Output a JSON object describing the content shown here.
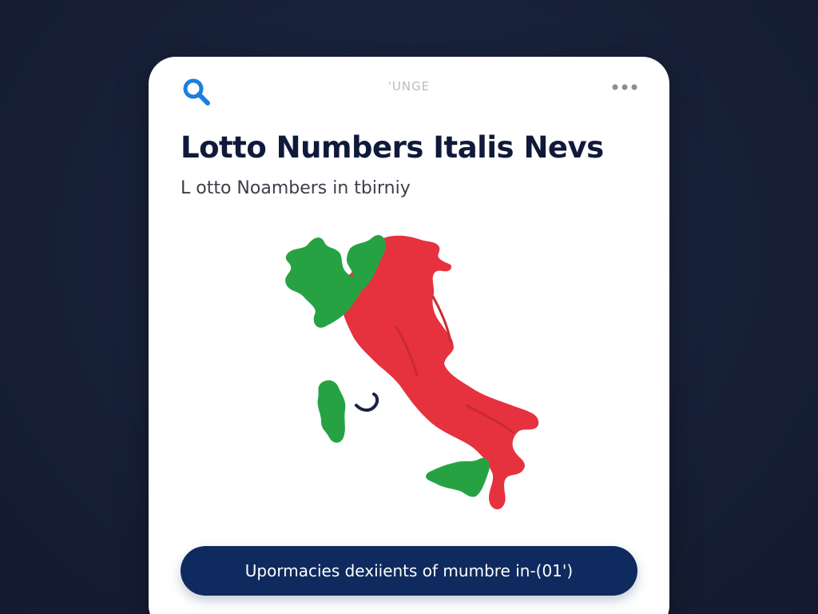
{
  "header": {
    "top_label": "'UNGE",
    "search_icon": "search-icon",
    "more_icon": "more-horizontal-icon"
  },
  "main": {
    "title": "Lotto Numbers Italis Nevs",
    "subtitle": "L otto Noambers in tbirniy",
    "map_icon": "italy-map-illustration"
  },
  "footer": {
    "cta_label": "Upormacies dexiients of mumbre in-(01')"
  },
  "colors": {
    "background": "#17213a",
    "card": "#ffffff",
    "title": "#0f1a3a",
    "accent_blue": "#1a7fe0",
    "map_red": "#e5323e",
    "map_green": "#27a243",
    "cta": "#0f2a5e"
  }
}
